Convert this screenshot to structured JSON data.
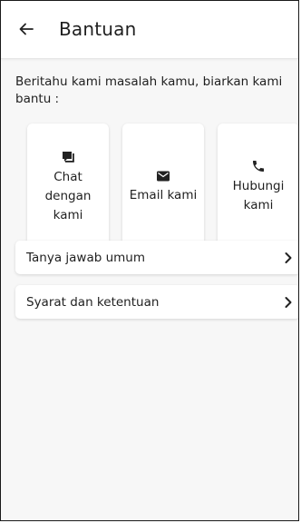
{
  "header": {
    "title": "Bantuan",
    "back_icon": "arrow-left-icon"
  },
  "intro_text": "Beritahu kami masalah kamu, biarkan kami bantu :",
  "contact_options": [
    {
      "label": "Chat\ndengan\nkami",
      "icon": "chat-icon"
    },
    {
      "label": "Email kami",
      "icon": "mail-icon"
    },
    {
      "label": "Hubungi\nkami",
      "icon": "phone-icon"
    }
  ],
  "menu": [
    {
      "label": "Tanya jawab umum",
      "icon": "chevron-right-icon"
    },
    {
      "label": "Syarat dan ketentuan",
      "icon": "chevron-right-icon"
    }
  ],
  "colors": {
    "background": "#f7f7f7",
    "surface": "#ffffff",
    "text": "#1f1f1f"
  }
}
